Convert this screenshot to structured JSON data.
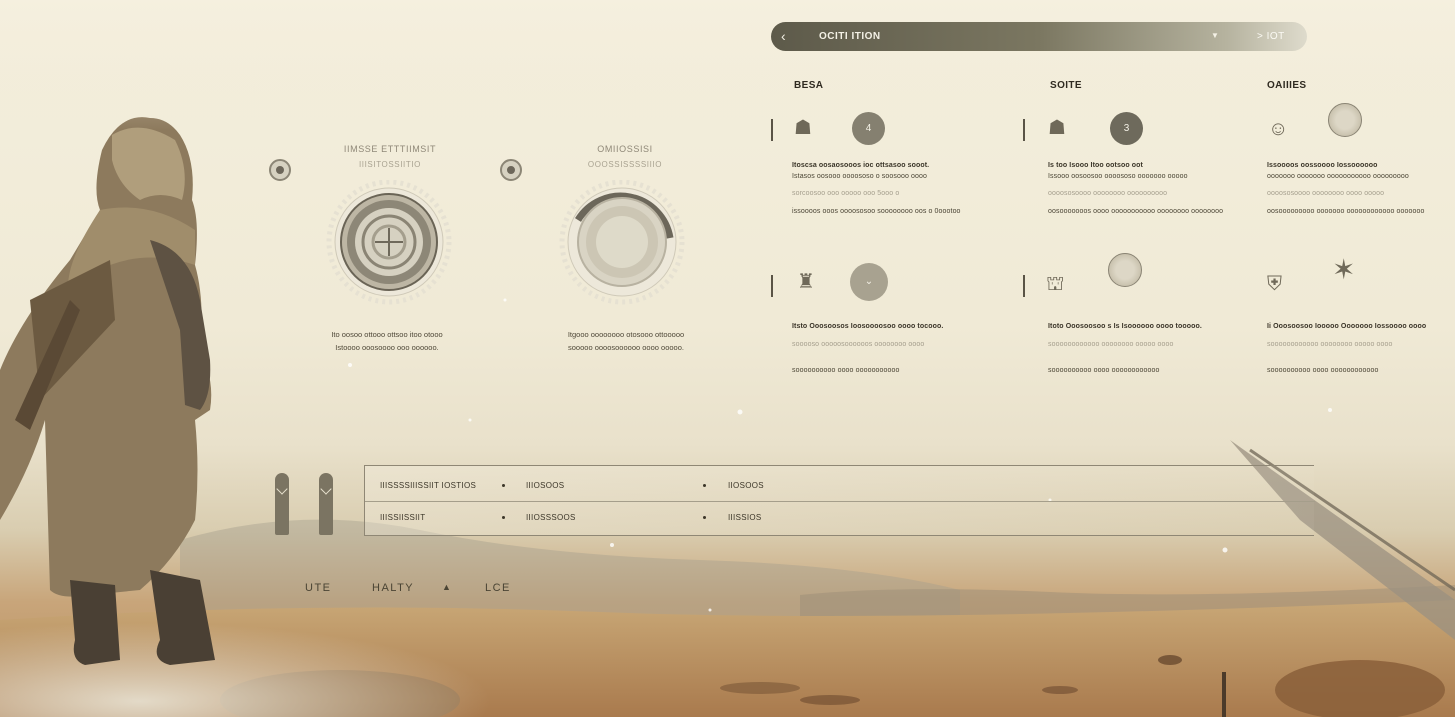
{
  "header": {
    "back_icon": "chevron-left-icon",
    "title": "OCITI ITION",
    "dropdown_icon": "caret-down-icon",
    "next_label": "> IOT"
  },
  "columns": [
    {
      "heading": "BESA",
      "row1_badge": "4",
      "row1_lines": [
        "Itoscsa oosaosooos ioc ottsasoo sooot.",
        "Istasos oosooo oooososo o soosooo oooo",
        "sorcoosoo ooo ooooo ooo 5ooo o",
        "issoooos ooos oooososoo soooooooo oos o 0oootoo"
      ],
      "row2_lines": [
        "Itsto Ooosoosos Ioosoooosoo oooo tocooo.",
        "sooooso ooooosoooooos oooooooo oooo",
        "soooooooooo oooo ooooooooooo"
      ]
    },
    {
      "heading": "SOITE",
      "row1_badge": "3",
      "row1_lines": [
        "Is too Isooo Itoo ootsoo oot",
        "Issooo oosoosoo oooososo ooooooo ooooo",
        "oooososoooo oooooooo oooooooooo",
        "oosooooooos oooo ooooooooooo oooooooo oooooooo"
      ],
      "row2_lines": [
        "Itoto Ooosoosoo s Is Isoooooo oooo tooooo.",
        "soooooooooooo oooooooo ooooo oooo",
        "soooooooooo oooo oooooooooooo"
      ]
    },
    {
      "heading": "OAIIIES",
      "row1_lines": [
        "Issoooos oossoooo Iossoooooo",
        "ooooooo ooooooo ooooooooooo ooooooooo",
        "oooososoooo oooooooo oooo ooooo",
        "oosooooooooo ooooooo oooooooooooo ooooooo"
      ],
      "row2_lines": [
        "Ii Ooosoosoo Iooooo Ooooooo Iossoooo oooo",
        "soooooooooooo oooooooo ooooo oooo",
        "soooooooooo oooo oooooooooooo"
      ]
    }
  ],
  "widgets": [
    {
      "title": "IIMSSE ETTTIIMSIT",
      "subtitle": "IIISITOSSIITIO",
      "caption": [
        "Ito oosoo ottooo ottsoo itoo otooo",
        "Istoooo ooosoooo ooo oooooo."
      ]
    },
    {
      "title": "OMIIOSSISI",
      "subtitle": "OOOSSISSSSIIIO",
      "caption": [
        "Itgooo oooooooo otosooo ottooooo",
        "sooooo oooosoooooo oooo ooooo."
      ]
    }
  ],
  "table": {
    "rows": [
      [
        "IIISSSSIIISSIIT IOSTIOS",
        "IIIOSOOS",
        "IIOSOOS"
      ],
      [
        "IIISSIISSIIT",
        "IIIOSSSOOS",
        "IIISSIOS"
      ]
    ]
  },
  "bottom_nav": {
    "item1": "UTE",
    "item2": "HALTY",
    "item3": "LCE",
    "triangle_icon": "triangle-up-icon"
  }
}
